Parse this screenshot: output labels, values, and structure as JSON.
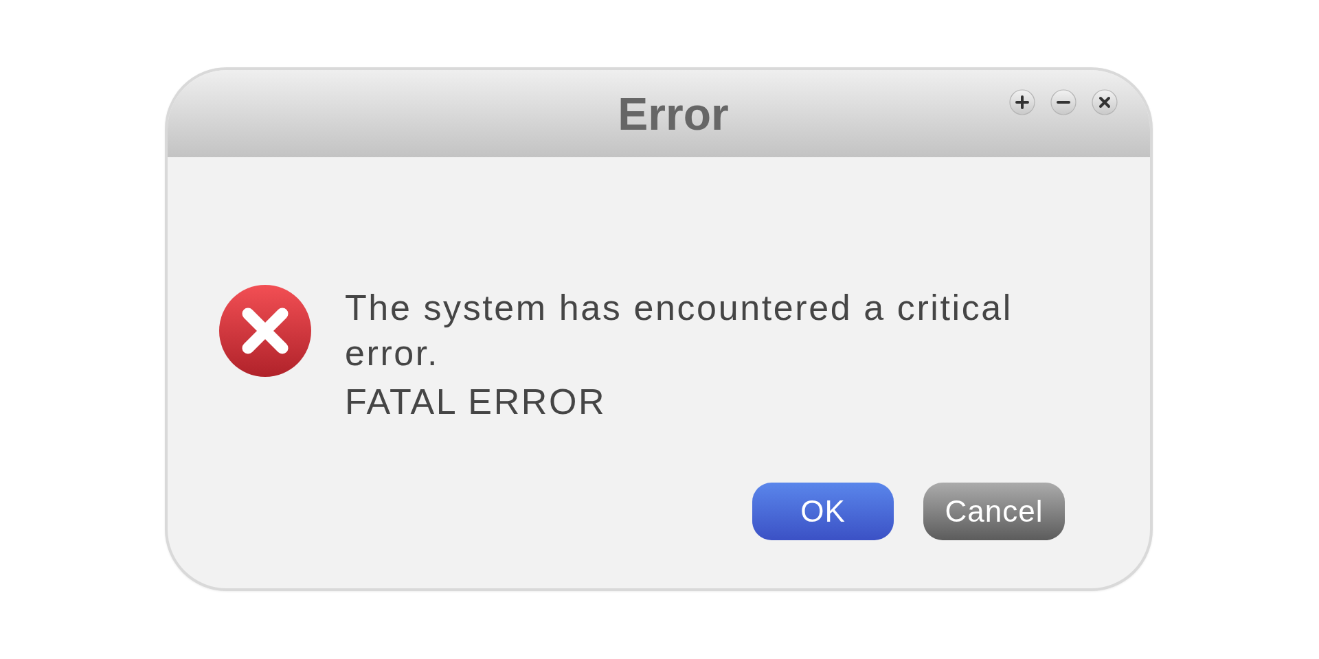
{
  "window": {
    "title": "Error"
  },
  "message": "The system has encountered a critical error.",
  "detail": "FATAL ERROR",
  "buttons": [
    {
      "label": "OK",
      "kind": "primary"
    },
    {
      "label": "Cancel",
      "kind": "secondary"
    }
  ]
}
